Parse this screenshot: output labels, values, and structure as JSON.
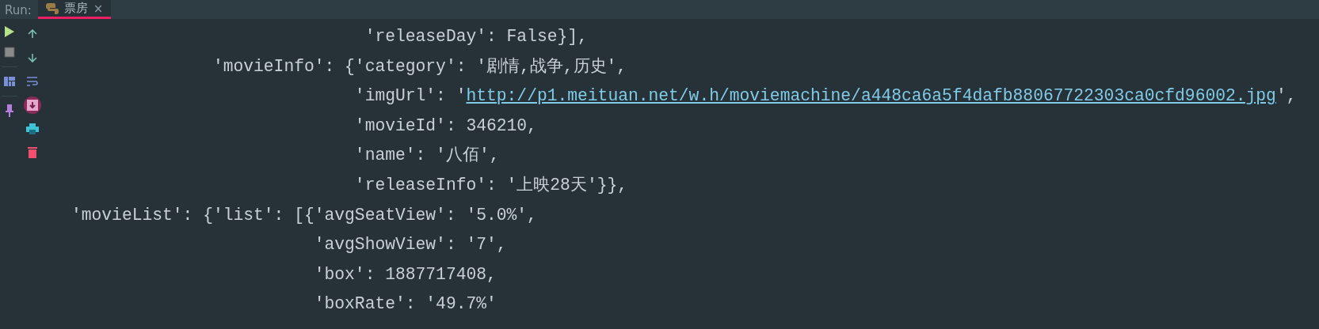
{
  "run_panel": {
    "label": "Run:",
    "tabs": [
      {
        "label": "票房",
        "selected": true,
        "close": "×"
      }
    ]
  },
  "toolbar_left": [
    {
      "kind": "run"
    },
    {
      "kind": "stop"
    },
    {
      "kind": "layout"
    },
    {
      "kind": "pin"
    }
  ],
  "toolbar_right": [
    {
      "kind": "up",
      "selected": false
    },
    {
      "kind": "down",
      "selected": false
    },
    {
      "kind": "wrap",
      "selected": false
    },
    {
      "kind": "scroll-end",
      "selected": true
    },
    {
      "kind": "print",
      "selected": false
    },
    {
      "kind": "trash",
      "selected": false
    }
  ],
  "console_lines": [
    [
      {
        "kind": "text",
        "text": "                             'releaseDay': False}],"
      }
    ],
    [
      {
        "kind": "text",
        "text": "              'movieInfo': {'category': '剧情,战争,历史',"
      }
    ],
    [
      {
        "kind": "text",
        "text": "                            'imgUrl': '"
      },
      {
        "kind": "link",
        "text": "http://p1.meituan.net/w.h/moviemachine/a448ca6a5f4dafb88067722303ca0cfd96002.jpg"
      },
      {
        "kind": "text",
        "text": "',"
      }
    ],
    [
      {
        "kind": "text",
        "text": "                            'movieId': 346210,"
      }
    ],
    [
      {
        "kind": "text",
        "text": "                            'name': '八佰',"
      }
    ],
    [
      {
        "kind": "text",
        "text": "                            'releaseInfo': '上映28天'}},"
      }
    ],
    [
      {
        "kind": "text",
        "text": "'movieList': {'list': [{'avgSeatView': '5.0%',"
      }
    ],
    [
      {
        "kind": "text",
        "text": "                        'avgShowView': '7',"
      }
    ],
    [
      {
        "kind": "text",
        "text": "                        'box': 1887717408,"
      }
    ],
    [
      {
        "kind": "text",
        "text": "                        'boxRate': '49.7%'"
      }
    ]
  ]
}
